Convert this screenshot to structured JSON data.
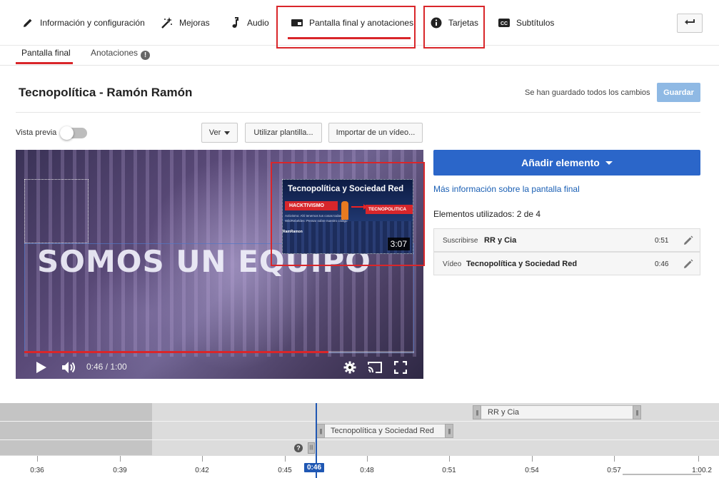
{
  "tabs": [
    {
      "label": "Información y configuración",
      "icon": "pencil-icon"
    },
    {
      "label": "Mejoras",
      "icon": "magic-wand-icon"
    },
    {
      "label": "Audio",
      "icon": "music-note-icon"
    },
    {
      "label": "Pantalla final y anotaciones",
      "icon": "end-screen-icon"
    },
    {
      "label": "Tarjetas",
      "icon": "info-circle-icon"
    },
    {
      "label": "Subtítulos",
      "icon": "cc-icon"
    }
  ],
  "subtabs": {
    "end_screen": "Pantalla final",
    "annotations": "Anotaciones",
    "annotations_badge": "!"
  },
  "video_title": "Tecnopolítica - Ramón Ramón",
  "save_status": "Se han guardado todos los cambios",
  "save_label": "Guardar",
  "preview": {
    "label": "Vista previa",
    "enabled": false
  },
  "toolbar": {
    "view": "Ver",
    "template": "Utilizar plantilla...",
    "import": "Importar de un vídeo..."
  },
  "player": {
    "overlay_text": "SOMOS UN EQUIPO",
    "time": "0:46 / 1:00",
    "progress_fraction": 0.78,
    "thumb": {
      "title": "Tecnopolítica y Sociedad Red",
      "tag_left": "HACKTIVISMO",
      "tag_right": "TECNOPOLITICA",
      "line1": "Activismo: Ahí tenemos tus cosas todas",
      "line2": "WikiRebeldes: Pensar sobre nuestro código",
      "brand": "RamRamon",
      "duration": "3:07"
    }
  },
  "panel": {
    "add_element": "Añadir elemento",
    "more_info": "Más información sobre la pantalla final",
    "elements_used": "Elementos utilizados: 2 de 4",
    "elements": [
      {
        "type": "Suscribirse",
        "name": "RR y Cia",
        "time": "0:51"
      },
      {
        "type": "Vídeo",
        "name": "Tecnopolítica y Sociedad Red",
        "time": "0:46"
      }
    ]
  },
  "timeline": {
    "bars": [
      {
        "label": "RR y Cia"
      },
      {
        "label": "Tecnopolítica y Sociedad Red"
      }
    ],
    "help": "?",
    "ticks": [
      "0:36",
      "0:39",
      "0:42",
      "0:45",
      "0:48",
      "0:51",
      "0:54",
      "0:57",
      "1:00.2"
    ],
    "playhead": "0:46"
  },
  "colors": {
    "accent_red": "#d9262a",
    "primary_blue": "#2b66c9",
    "link_blue": "#1a5fb4",
    "save_disabled": "#8fb9e4"
  }
}
